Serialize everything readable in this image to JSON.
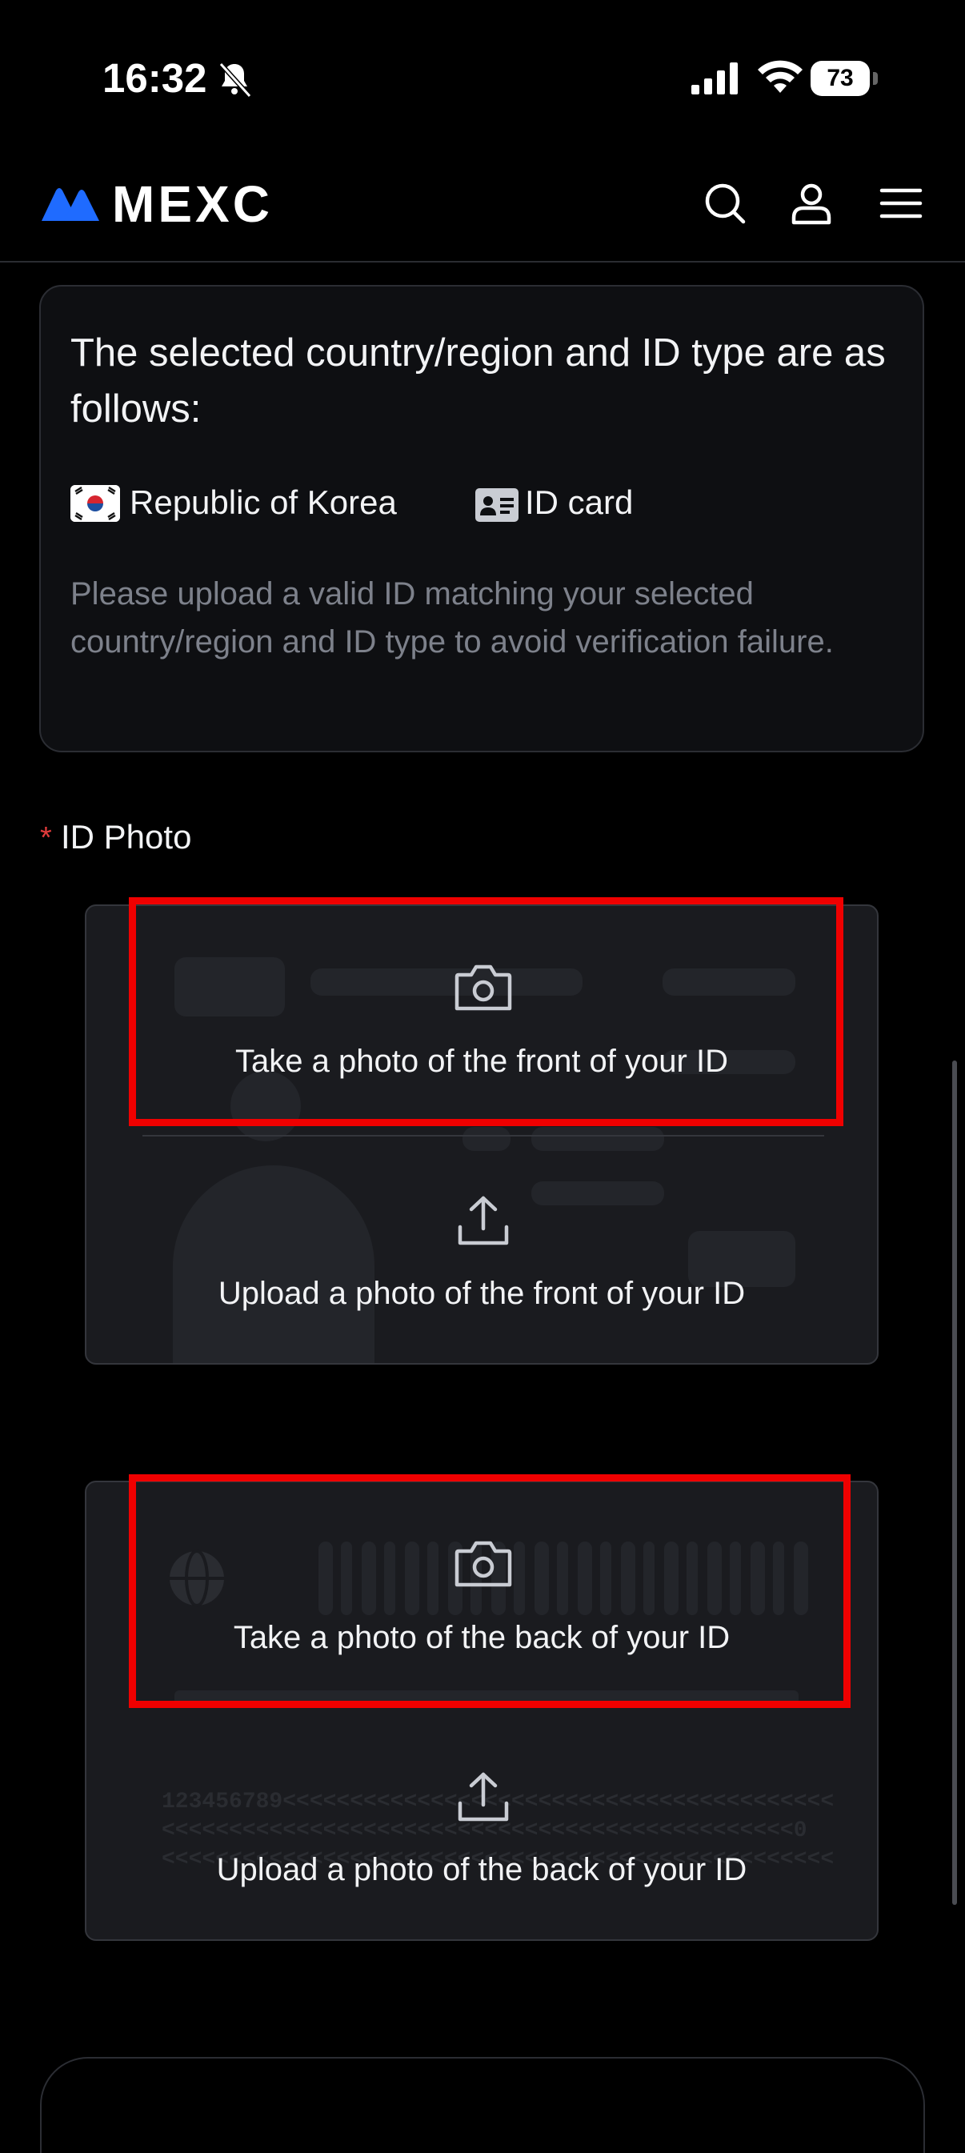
{
  "status_bar": {
    "time": "16:32",
    "battery": "73"
  },
  "header": {
    "brand": "MEXC"
  },
  "info_card": {
    "title": "The selected country/region and ID type are as follows:",
    "country": "Republic of Korea",
    "id_type": "ID card",
    "note": "Please upload a valid ID matching your selected country/region and ID type to avoid verification failure."
  },
  "id_photo": {
    "required_mark": "*",
    "label": "ID Photo",
    "front": {
      "take_label": "Take a photo of the front of your ID",
      "upload_label": "Upload a photo of the front of your ID"
    },
    "back": {
      "take_label": "Take a photo of the back of your ID",
      "upload_label": "Upload a photo of the back of your ID",
      "mrz_line1": "123456789<<<<<<<<<<<<<<<<<<<<<<<<<<<<<<<<<<<<<<<<<",
      "mrz_line2": "<<<<<<<<<<<<<<<<<<<<<<<<<<<<<<<<<<<<<<<<<<<<<<<0",
      "mrz_line3": "<<<<<<<<<<<<<<<<<<<<<<<<<<<<<<<<<<<<<<<<<<<<<<<<<<"
    }
  },
  "colors": {
    "accent": "#1f6bff",
    "highlight": "#ef0000",
    "required": "#e23b3b"
  }
}
